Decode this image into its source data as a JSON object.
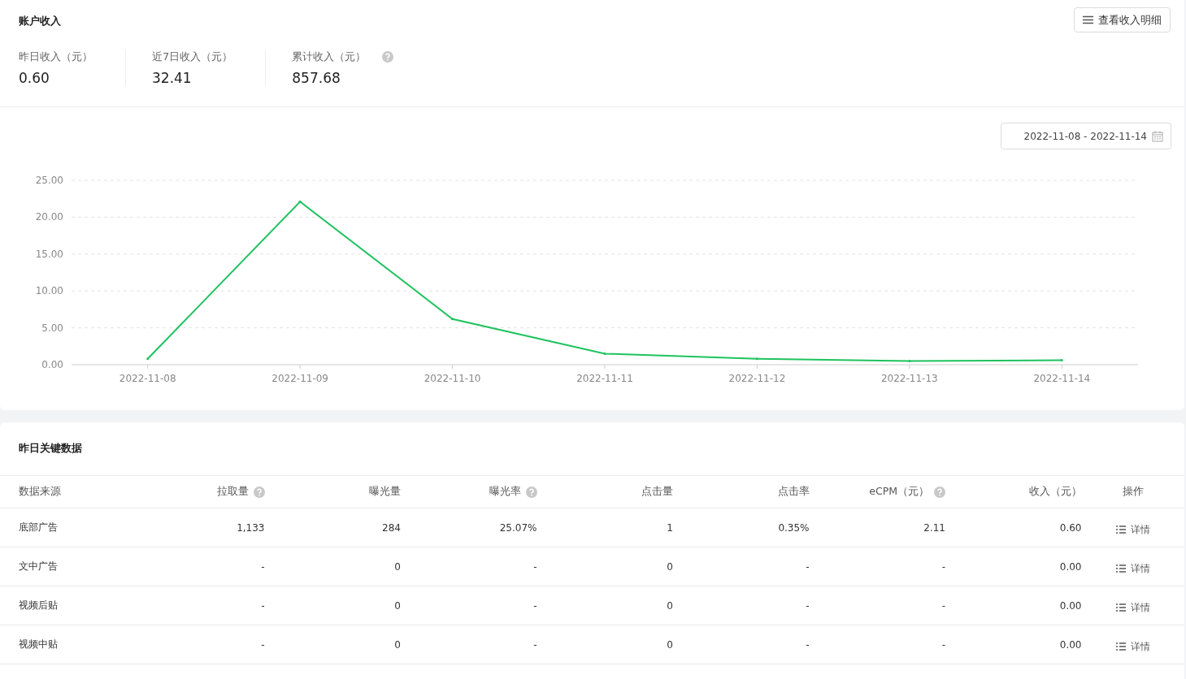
{
  "income": {
    "title": "账户收入",
    "detail_button": "查看收入明细",
    "stats": [
      {
        "label": "昨日收入（元）",
        "value": "0.60",
        "help": false
      },
      {
        "label": "近7日收入（元）",
        "value": "32.41",
        "help": false
      },
      {
        "label": "累计收入（元）",
        "value": "857.68",
        "help": true
      }
    ],
    "date_range": "2022-11-08 - 2022-11-14",
    "chart_data": {
      "type": "line",
      "categories": [
        "2022-11-08",
        "2022-11-09",
        "2022-11-10",
        "2022-11-11",
        "2022-11-12",
        "2022-11-13",
        "2022-11-14"
      ],
      "series": [
        {
          "color": "#1ec25e",
          "values": [
            0.8,
            22.1,
            6.2,
            1.5,
            0.8,
            0.5,
            0.6
          ]
        }
      ],
      "grid": true,
      "ylim": [
        0,
        25
      ],
      "yticks": [
        {
          "value": 0,
          "label": "0.00"
        },
        {
          "value": 5,
          "label": "5.00"
        },
        {
          "value": 10,
          "label": "10.00"
        },
        {
          "value": 15,
          "label": "15.00"
        },
        {
          "value": 20,
          "label": "20.00"
        },
        {
          "value": 25,
          "label": "25.00"
        }
      ]
    }
  },
  "key_data": {
    "title": "昨日关键数据",
    "columns": [
      {
        "label": "数据来源",
        "help": false
      },
      {
        "label": "拉取量",
        "help": true
      },
      {
        "label": "曝光量",
        "help": false
      },
      {
        "label": "曝光率",
        "help": true
      },
      {
        "label": "点击量",
        "help": false
      },
      {
        "label": "点击率",
        "help": false
      },
      {
        "label": "eCPM（元）",
        "help": true
      },
      {
        "label": "收入（元）",
        "help": false
      },
      {
        "label": "操作",
        "help": false
      }
    ],
    "rows": [
      {
        "cells": [
          "底部广告",
          "1,133",
          "284",
          "25.07%",
          "1",
          "0.35%",
          "2.11",
          "0.60"
        ],
        "action": "详情"
      },
      {
        "cells": [
          "文中广告",
          "-",
          "0",
          "-",
          "0",
          "-",
          "-",
          "0.00"
        ],
        "action": "详情"
      },
      {
        "cells": [
          "视频后贴",
          "-",
          "0",
          "-",
          "0",
          "-",
          "-",
          "0.00"
        ],
        "action": "详情"
      },
      {
        "cells": [
          "视频中贴",
          "-",
          "0",
          "-",
          "0",
          "-",
          "-",
          "0.00"
        ],
        "action": "详情"
      }
    ]
  }
}
